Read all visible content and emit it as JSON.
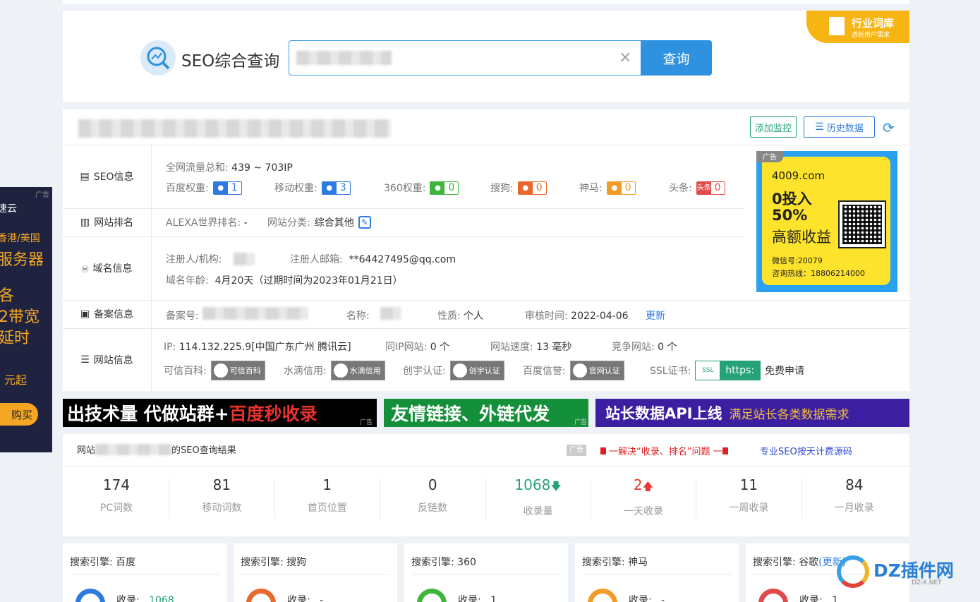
{
  "search": {
    "title": "SEO综合查询",
    "button": "查询",
    "clear": "×"
  },
  "ribbon": {
    "title": "行业词库",
    "sub": "透析用户需求"
  },
  "site": {
    "add_monitor": "添加监控",
    "history": "历史数据"
  },
  "seo": {
    "label": "SEO信息",
    "traffic_key": "全网流量总和:",
    "traffic_val": "439 ~ 703IP",
    "weights": [
      {
        "key": "百度权重:",
        "val": "1",
        "color": "#2e7be0"
      },
      {
        "key": "移动权重:",
        "val": "3",
        "color": "#2e7be0"
      },
      {
        "key": "360权重:",
        "val": "0",
        "color": "#3fb53b"
      },
      {
        "key": "搜狗:",
        "val": "0",
        "color": "#e9682c"
      },
      {
        "key": "神马:",
        "val": "0",
        "color": "#f29b26"
      },
      {
        "key": "头条:",
        "val": "0",
        "color": "#e04a4a"
      }
    ],
    "toutiao_icon": "头条"
  },
  "rank": {
    "label": "网站排名",
    "alexa_key": "ALEXA世界排名:",
    "alexa_val": "-",
    "cat_key": "网站分类:",
    "cat_val": "综合其他"
  },
  "domain": {
    "label": "域名信息",
    "reg_key": "注册人/机构:",
    "email_key": "注册人邮箱:",
    "email_val": "**64427495@qq.com",
    "age_key": "域名年龄:",
    "age_val": "4月20天（过期时间为2023年01月21日）"
  },
  "beian": {
    "label": "备案信息",
    "no_key": "备案号:",
    "name_key": "名称:",
    "type_key": "性质:",
    "type_val": "个人",
    "time_key": "审核时间:",
    "time_val": "2022-04-06",
    "update": "更新"
  },
  "netinfo": {
    "label": "网站信息",
    "ip_key": "IP:",
    "ip_val": "114.132.225.9[中国广东广州 腾讯云]",
    "sameip_key": "同IP网站:",
    "sameip_val": "0 个",
    "speed_key": "网站速度:",
    "speed_val": "13 毫秒",
    "compete_key": "竞争网站:",
    "compete_val": "0 个",
    "certs": [
      {
        "key": "可信百科:",
        "val": "可信百科"
      },
      {
        "key": "水滴信用:",
        "val": "水滴信用"
      },
      {
        "key": "创宇认证:",
        "val": "创宇认证"
      },
      {
        "key": "百度信誉:",
        "val": "官网认证"
      }
    ],
    "ssl_key": "SSL证书:",
    "ssl_icon": "SSL",
    "ssl_https": "https:",
    "ssl_free": "免费申请"
  },
  "ad_right": {
    "tag": "广告",
    "domain": "4009.com",
    "line1": "0投入",
    "line2": "50%",
    "line3": "高额收益",
    "wechat": "微信号:20079",
    "phone": "咨询热线：18806214000"
  },
  "ad_left": {
    "tag": "广告",
    "brand": "速云",
    "region": "香港/美国",
    "server": "服务器",
    "l1": "各",
    "l2": "2带宽",
    "l3": "延时",
    "price": "元起",
    "buy": "购买"
  },
  "banners": [
    {
      "a": "出技术量 代做站群+",
      "b": "百度秒收录",
      "tag": "广告"
    },
    {
      "a": "友情链接、外链代发",
      "b": "",
      "tag": "广告"
    },
    {
      "a": "站长数据API上线",
      "b": "满足站长各类数据需求",
      "tag": ""
    }
  ],
  "results": {
    "prefix": "网站",
    "suffix": "的SEO查询结果",
    "ad": "广告",
    "promo": "一解决“收录、排名”问题 一",
    "promo2": "专业SEO按天计费源码",
    "stats": [
      {
        "n": "174",
        "l": "PC词数",
        "c": "#333"
      },
      {
        "n": "81",
        "l": "移动词数",
        "c": "#333"
      },
      {
        "n": "1",
        "l": "首页位置",
        "c": "#333"
      },
      {
        "n": "0",
        "l": "反链数",
        "c": "#333"
      },
      {
        "n": "1068",
        "l": "收录量",
        "c": "#26a27a",
        "arrow": "🡇"
      },
      {
        "n": "2",
        "l": "一天收录",
        "c": "#e83a2f",
        "arrow": "🡅"
      },
      {
        "n": "11",
        "l": "一周收录",
        "c": "#333"
      },
      {
        "n": "84",
        "l": "一月收录",
        "c": "#333"
      }
    ]
  },
  "engines": [
    {
      "t": "搜索引擎: 百度",
      "s": "收录:",
      "v": "1068",
      "vc": "#26a27a",
      "ic": "#2e7be0"
    },
    {
      "t": "搜索引擎: 搜狗",
      "s": "收录:",
      "v": "-",
      "vc": "#333",
      "ic": "#e9682c"
    },
    {
      "t": "搜索引擎: 360",
      "s": "收录:",
      "v": "1",
      "vc": "#333",
      "ic": "#3fb53b"
    },
    {
      "t": "搜索引擎: 神马",
      "s": "收录:",
      "v": "-",
      "vc": "#333",
      "ic": "#f29b26"
    },
    {
      "t": "搜索引擎: 谷歌",
      "t2": "(更新)",
      "s": "收录:",
      "v": "1",
      "vc": "#333",
      "ic": "#e04a4a"
    }
  ],
  "watermark": {
    "brand": "DZ插件网",
    "url": "DZ-X.NET"
  }
}
